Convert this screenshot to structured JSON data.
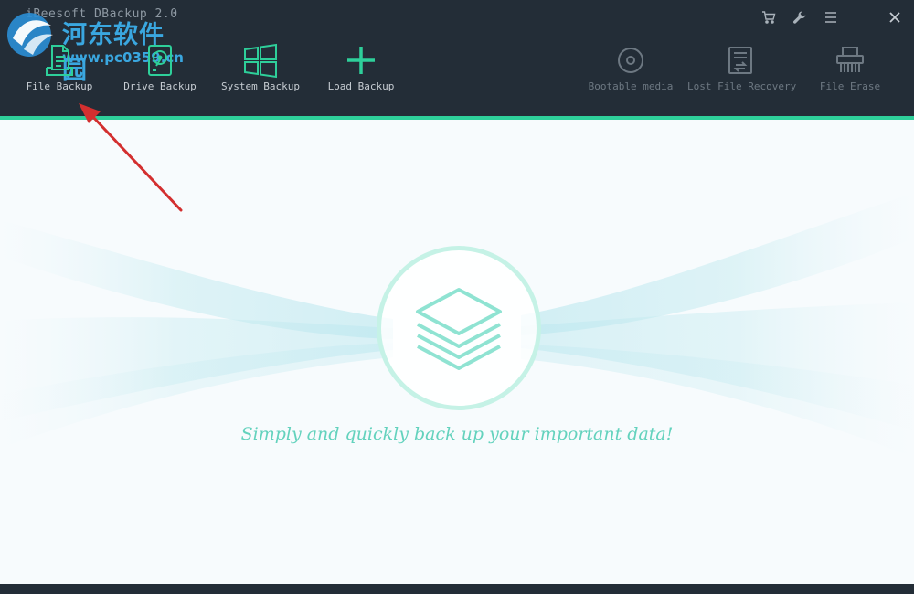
{
  "window": {
    "title": "iBeesoft DBackup 2.0"
  },
  "watermark": {
    "text_cn": "河东软件园",
    "url": "www.pc0359.cn"
  },
  "system_buttons": [
    {
      "name": "cart-icon"
    },
    {
      "name": "wrench-icon"
    },
    {
      "name": "menu-icon"
    },
    {
      "name": "close-icon"
    }
  ],
  "toolbar": {
    "file_backup": "File Backup",
    "drive_backup": "Drive Backup",
    "system_backup": "System Backup",
    "load_backup": "Load Backup",
    "bootable_media": "Bootable media",
    "lost_file_recovery": "Lost File Recovery",
    "file_erase": "File Erase"
  },
  "main": {
    "tagline": "Simply and quickly back up your important data!"
  },
  "colors": {
    "accent": "#2ecf9a",
    "header_bg": "#232d37",
    "tagline": "#63d2bd",
    "arrow": "#d32f2f"
  }
}
